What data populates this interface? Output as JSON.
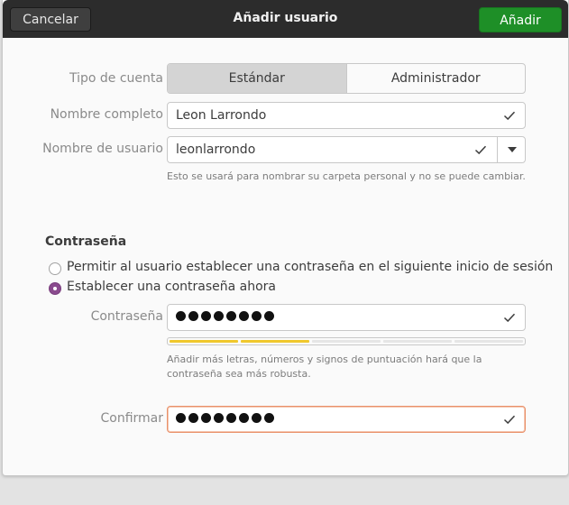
{
  "window": {
    "title": "Añadir usuario",
    "cancel_label": "Cancelar",
    "add_label": "Añadir"
  },
  "account_type": {
    "label": "Tipo de cuenta",
    "options": [
      "Estándar",
      "Administrador"
    ],
    "selected": "Estándar"
  },
  "full_name": {
    "label": "Nombre completo",
    "value": "Leon Larrondo"
  },
  "username": {
    "label": "Nombre de usuario",
    "value": "leonlarrondo",
    "hint": "Esto se usará para nombrar su carpeta personal y no se puede cambiar."
  },
  "password_section": {
    "title": "Contraseña",
    "option_later": "Permitir al usuario establecer una contraseña en el siguiente inicio de sesión",
    "option_now": "Establecer una contraseña ahora",
    "selected_option": "option_now"
  },
  "password": {
    "label": "Contraseña",
    "masked_length": 8,
    "strength_filled_segments": 2,
    "strength_total_segments": 5,
    "hint": "Añadir más letras, números y signos de puntuación hará que la contraseña sea más robusta."
  },
  "confirm": {
    "label": "Confirmar",
    "masked_length": 8
  },
  "colors": {
    "headerbar": "#2c2c2c",
    "add_button": "#1e8f27",
    "radio_selected": "#8a4a8e",
    "strength_bar": "#f0c82d",
    "focus_border": "#e9916a"
  }
}
